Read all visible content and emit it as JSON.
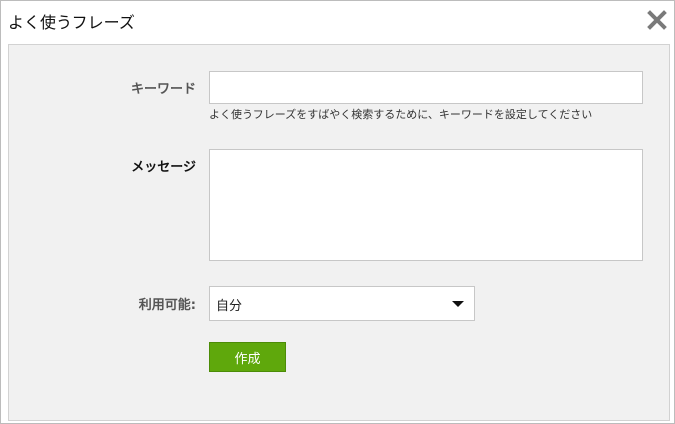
{
  "dialog": {
    "title": "よく使うフレーズ",
    "close_icon": "close-x-icon"
  },
  "form": {
    "keyword": {
      "label": "キーワード",
      "value": "",
      "placeholder": "",
      "hint": "よく使うフレーズをすばやく検索するために、キーワードを設定してください"
    },
    "message": {
      "label": "メッセージ",
      "value": "",
      "placeholder": ""
    },
    "availability": {
      "label": "利用可能:",
      "selected": "自分"
    },
    "create_button_label": "作成"
  },
  "colors": {
    "button": "#5fa80c",
    "panel": "#f1f1f1",
    "border": "#c7c7c7"
  }
}
